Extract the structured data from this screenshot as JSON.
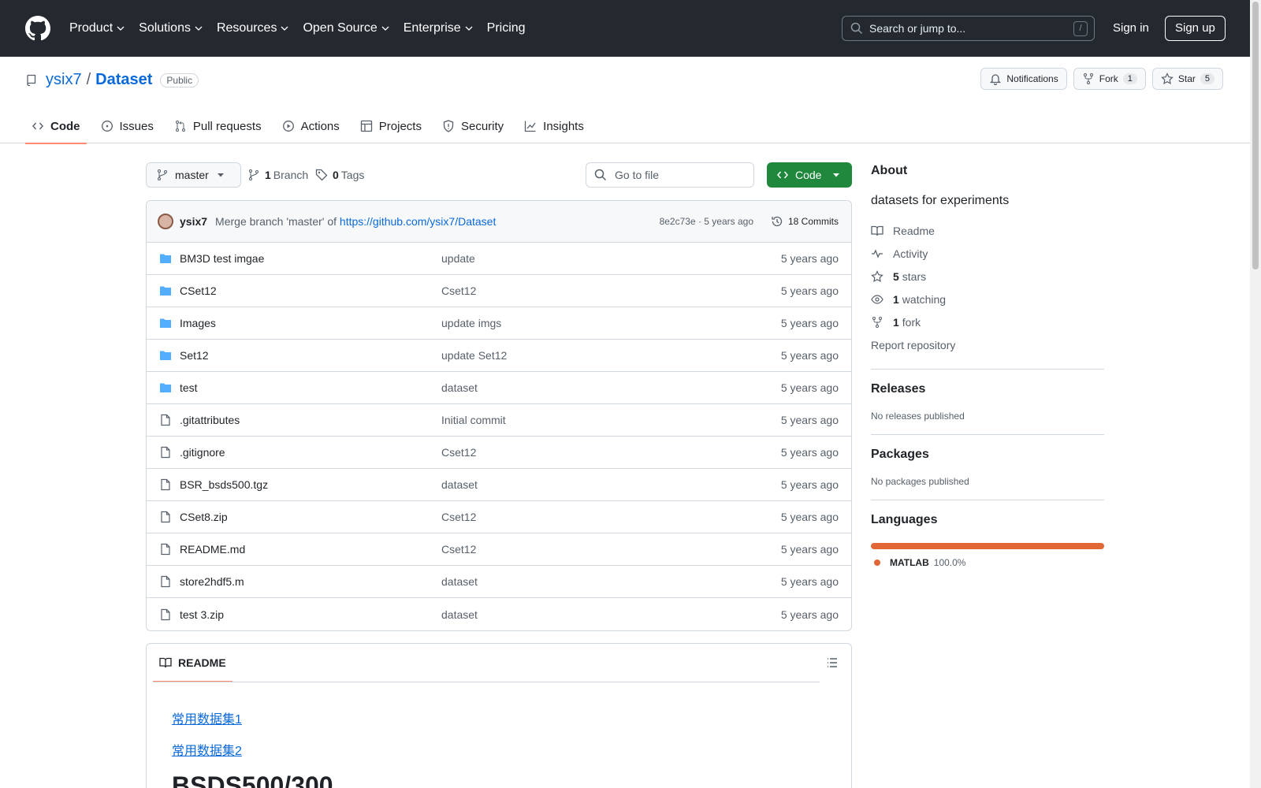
{
  "header": {
    "nav": [
      {
        "label": "Product",
        "dropdown": true
      },
      {
        "label": "Solutions",
        "dropdown": true
      },
      {
        "label": "Resources",
        "dropdown": true
      },
      {
        "label": "Open Source",
        "dropdown": true
      },
      {
        "label": "Enterprise",
        "dropdown": true
      },
      {
        "label": "Pricing",
        "dropdown": false
      }
    ],
    "search_placeholder": "Search or jump to...",
    "search_shortcut": "/",
    "sign_in": "Sign in",
    "sign_up": "Sign up"
  },
  "repo": {
    "owner": "ysix7",
    "separator": "/",
    "name": "Dataset",
    "visibility": "Public",
    "notifications_label": "Notifications",
    "fork_label": "Fork",
    "fork_count": "1",
    "star_label": "Star",
    "star_count": "5"
  },
  "tabs": [
    {
      "label": "Code",
      "icon": "code-icon",
      "active": true
    },
    {
      "label": "Issues",
      "icon": "issue-icon",
      "active": false
    },
    {
      "label": "Pull requests",
      "icon": "pull-request-icon",
      "active": false
    },
    {
      "label": "Actions",
      "icon": "play-icon",
      "active": false
    },
    {
      "label": "Projects",
      "icon": "table-icon",
      "active": false
    },
    {
      "label": "Security",
      "icon": "shield-icon",
      "active": false
    },
    {
      "label": "Insights",
      "icon": "graph-icon",
      "active": false
    }
  ],
  "toolbar": {
    "branch": "master",
    "branch_count": "1",
    "branch_label": "Branch",
    "tag_count": "0",
    "tag_label": "Tags",
    "goto_placeholder": "Go to file",
    "code_button": "Code"
  },
  "commit": {
    "author": "ysix7",
    "message_prefix": "Merge branch 'master' of",
    "message_link": "https://github.com/ysix7/Dataset",
    "hash_time": "8e2c73e · 5 years ago",
    "commits_label": "18 Commits"
  },
  "files": [
    {
      "type": "folder",
      "name": "BM3D test imgae",
      "message": "update",
      "date": "5 years ago"
    },
    {
      "type": "folder",
      "name": "CSet12",
      "message": "Cset12",
      "date": "5 years ago"
    },
    {
      "type": "folder",
      "name": "Images",
      "message": "update imgs",
      "date": "5 years ago"
    },
    {
      "type": "folder",
      "name": "Set12",
      "message": "update Set12",
      "date": "5 years ago"
    },
    {
      "type": "folder",
      "name": "test",
      "message": "dataset",
      "date": "5 years ago"
    },
    {
      "type": "file",
      "name": ".gitattributes",
      "message": "Initial commit",
      "date": "5 years ago"
    },
    {
      "type": "file",
      "name": ".gitignore",
      "message": "Cset12",
      "date": "5 years ago"
    },
    {
      "type": "file",
      "name": "BSR_bsds500.tgz",
      "message": "dataset",
      "date": "5 years ago"
    },
    {
      "type": "file",
      "name": "CSet8.zip",
      "message": "Cset12",
      "date": "5 years ago"
    },
    {
      "type": "file",
      "name": "README.md",
      "message": "Cset12",
      "date": "5 years ago"
    },
    {
      "type": "file",
      "name": "store2hdf5.m",
      "message": "dataset",
      "date": "5 years ago"
    },
    {
      "type": "file",
      "name": "test 3.zip",
      "message": "dataset",
      "date": "5 years ago"
    }
  ],
  "readme": {
    "tab_label": "README",
    "links": [
      "常用数据集1",
      "常用数据集2"
    ],
    "heading": "BSDS500/300"
  },
  "sidebar": {
    "about_title": "About",
    "description": "datasets for experiments",
    "items": [
      {
        "icon": "book-icon",
        "bold": "",
        "text": "Readme"
      },
      {
        "icon": "pulse-icon",
        "bold": "",
        "text": "Activity"
      },
      {
        "icon": "star-icon",
        "bold": "5",
        "text": "stars"
      },
      {
        "icon": "eye-icon",
        "bold": "1",
        "text": "watching"
      },
      {
        "icon": "fork-icon",
        "bold": "1",
        "text": "fork"
      }
    ],
    "report": "Report repository",
    "releases_title": "Releases",
    "releases_text": "No releases published",
    "packages_title": "Packages",
    "packages_text": "No packages published",
    "languages_title": "Languages",
    "language_name": "MATLAB",
    "language_pct": "100.0%",
    "language_color": "#e16737"
  }
}
